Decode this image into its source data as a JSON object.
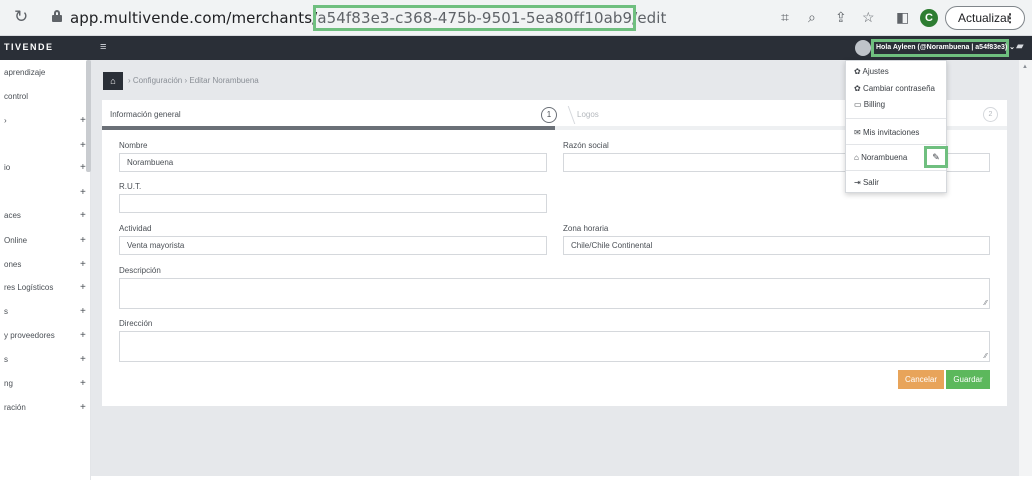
{
  "browser": {
    "url_prefix": "app.multivende.com/merchants/",
    "url_highlight": "a54f83e3-c368-475b-9501-5ea80ff10ab9",
    "url_suffix": "/edit",
    "profile_initial": "C",
    "update_label": "Actualizar",
    "menu_glyph": "⋮"
  },
  "navbar": {
    "brand": "TIVENDE",
    "menu_icon": "≡",
    "greeting": "Hola Ayleen (@Norambuena | a54f83e3) ⌄",
    "chat_icon": "chat-icon"
  },
  "sidebar": {
    "items": [
      {
        "label": "aprendizaje",
        "plus": ""
      },
      {
        "label": "control",
        "plus": ""
      },
      {
        "label": "›",
        "plus": "+"
      },
      {
        "label": "",
        "plus": "+"
      },
      {
        "label": "io",
        "plus": "+"
      },
      {
        "label": "",
        "plus": "+"
      },
      {
        "label": "aces",
        "plus": "+"
      },
      {
        "label": "Online",
        "plus": "+"
      },
      {
        "label": "ones",
        "plus": "+"
      },
      {
        "label": "res Logísticos",
        "plus": "+"
      },
      {
        "label": "s",
        "plus": "+"
      },
      {
        "label": "y proveedores",
        "plus": "+"
      },
      {
        "label": "s",
        "plus": "+"
      },
      {
        "label": "ng",
        "plus": "+"
      },
      {
        "label": "ración",
        "plus": "+"
      }
    ]
  },
  "breadcrumb": {
    "home_icon": "⌂",
    "text": "›   Configuración  ›  Editar Norambuena"
  },
  "wizard": {
    "tab1_label": "Información general",
    "tab1_num": "1",
    "tab2_label": "Logos",
    "tab2_num": "2",
    "progress": 0.5
  },
  "form": {
    "nombre_label": "Nombre",
    "nombre_value": "Norambuena",
    "razon_label": "Razón social",
    "razon_value": "",
    "rut_label": "R.U.T.",
    "rut_value": "",
    "actividad_label": "Actividad",
    "actividad_value": "Venta mayorista",
    "zona_label": "Zona horaria",
    "zona_value": "Chile/Chile Continental",
    "descripcion_label": "Descripción",
    "direccion_label": "Dirección"
  },
  "actions": {
    "cancel": "Cancelar",
    "save": "Guardar"
  },
  "user_menu": {
    "ajustes": "Ajustes",
    "cambiar": "Cambiar contraseña",
    "billing": "Billing",
    "invitaciones": "Mis invitaciones",
    "merchant": "Norambuena",
    "salir": "Salir",
    "edit_icon": "✎"
  },
  "colors": {
    "navbar": "#2a2f37",
    "highlight": "#6fbf7f",
    "cancel": "#e8a45a",
    "save": "#5cb85c"
  }
}
